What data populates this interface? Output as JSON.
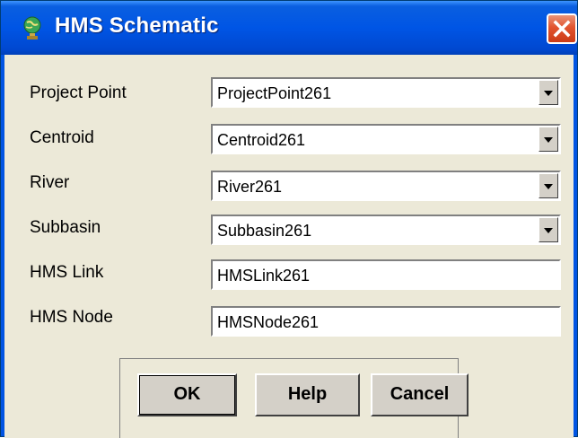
{
  "window": {
    "title": "HMS Schematic",
    "icon": "globe-pin-icon",
    "close_icon": "close-icon",
    "accent_color": "#0054e3",
    "close_color": "#e2542f"
  },
  "fields": [
    {
      "label": "Project Point",
      "value": "ProjectPoint261",
      "type": "combo"
    },
    {
      "label": "Centroid",
      "value": "Centroid261",
      "type": "combo"
    },
    {
      "label": "River",
      "value": "River261",
      "type": "combo"
    },
    {
      "label": "Subbasin",
      "value": "Subbasin261",
      "type": "combo"
    },
    {
      "label": "HMS Link",
      "value": "HMSLink261",
      "type": "text"
    },
    {
      "label": "HMS Node",
      "value": "HMSNode261",
      "type": "text"
    }
  ],
  "buttons": {
    "ok": "OK",
    "help": "Help",
    "cancel": "Cancel"
  }
}
